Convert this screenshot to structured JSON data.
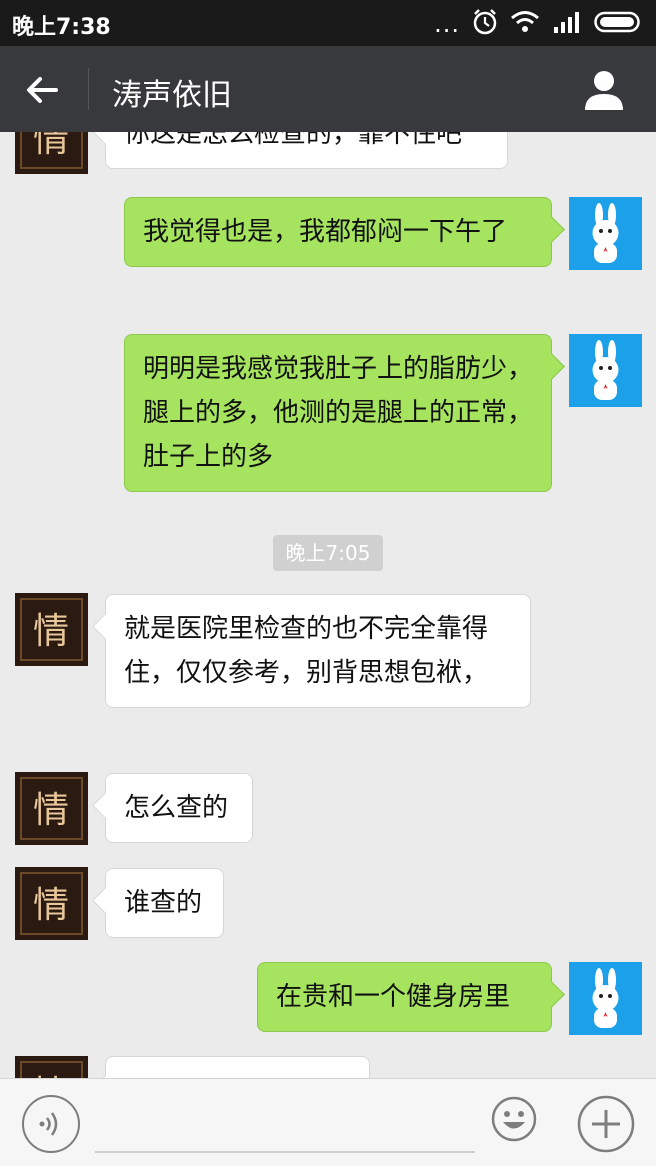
{
  "status_bar": {
    "time": "晚上7:38",
    "icons": [
      "more-dots-icon",
      "alarm-icon",
      "wifi-icon",
      "signal-icon",
      "battery-icon"
    ],
    "dots": "..."
  },
  "header": {
    "title": "涛声依旧",
    "back_icon": "back-arrow-icon",
    "profile_icon": "person-icon"
  },
  "messages": [
    {
      "side": "recv",
      "text": "你这是怎么检查的，靠不住吧"
    },
    {
      "side": "sent",
      "text": "我觉得也是，我都郁闷一下午了"
    },
    {
      "side": "sent",
      "text": "明明是我感觉我肚子上的脂肪少，腿上的多，他测的是腿上的正常，肚子上的多"
    },
    {
      "side": "time",
      "text": "晚上7:05"
    },
    {
      "side": "recv",
      "text": "就是医院里检查的也不完全靠得住，仅仅参考，别背思想包袱，"
    },
    {
      "side": "recv",
      "text": "怎么查的"
    },
    {
      "side": "recv",
      "text": "谁查的"
    },
    {
      "side": "sent",
      "text": "在贵和一个健身房里"
    },
    {
      "side": "recv",
      "text": ""
    }
  ],
  "input_bar": {
    "voice_icon": "voice-icon",
    "input_value": "",
    "emoji_icon": "emoji-icon",
    "plus_icon": "plus-icon"
  },
  "colors": {
    "status_bg": "#1a1a1a",
    "header_bg": "#38393d",
    "chat_bg": "#ebebeb",
    "sent_bubble": "#a6e35f",
    "recv_bubble": "#ffffff",
    "my_avatar_bg": "#1da0ea",
    "friend_avatar_bg": "#2a1a12"
  }
}
